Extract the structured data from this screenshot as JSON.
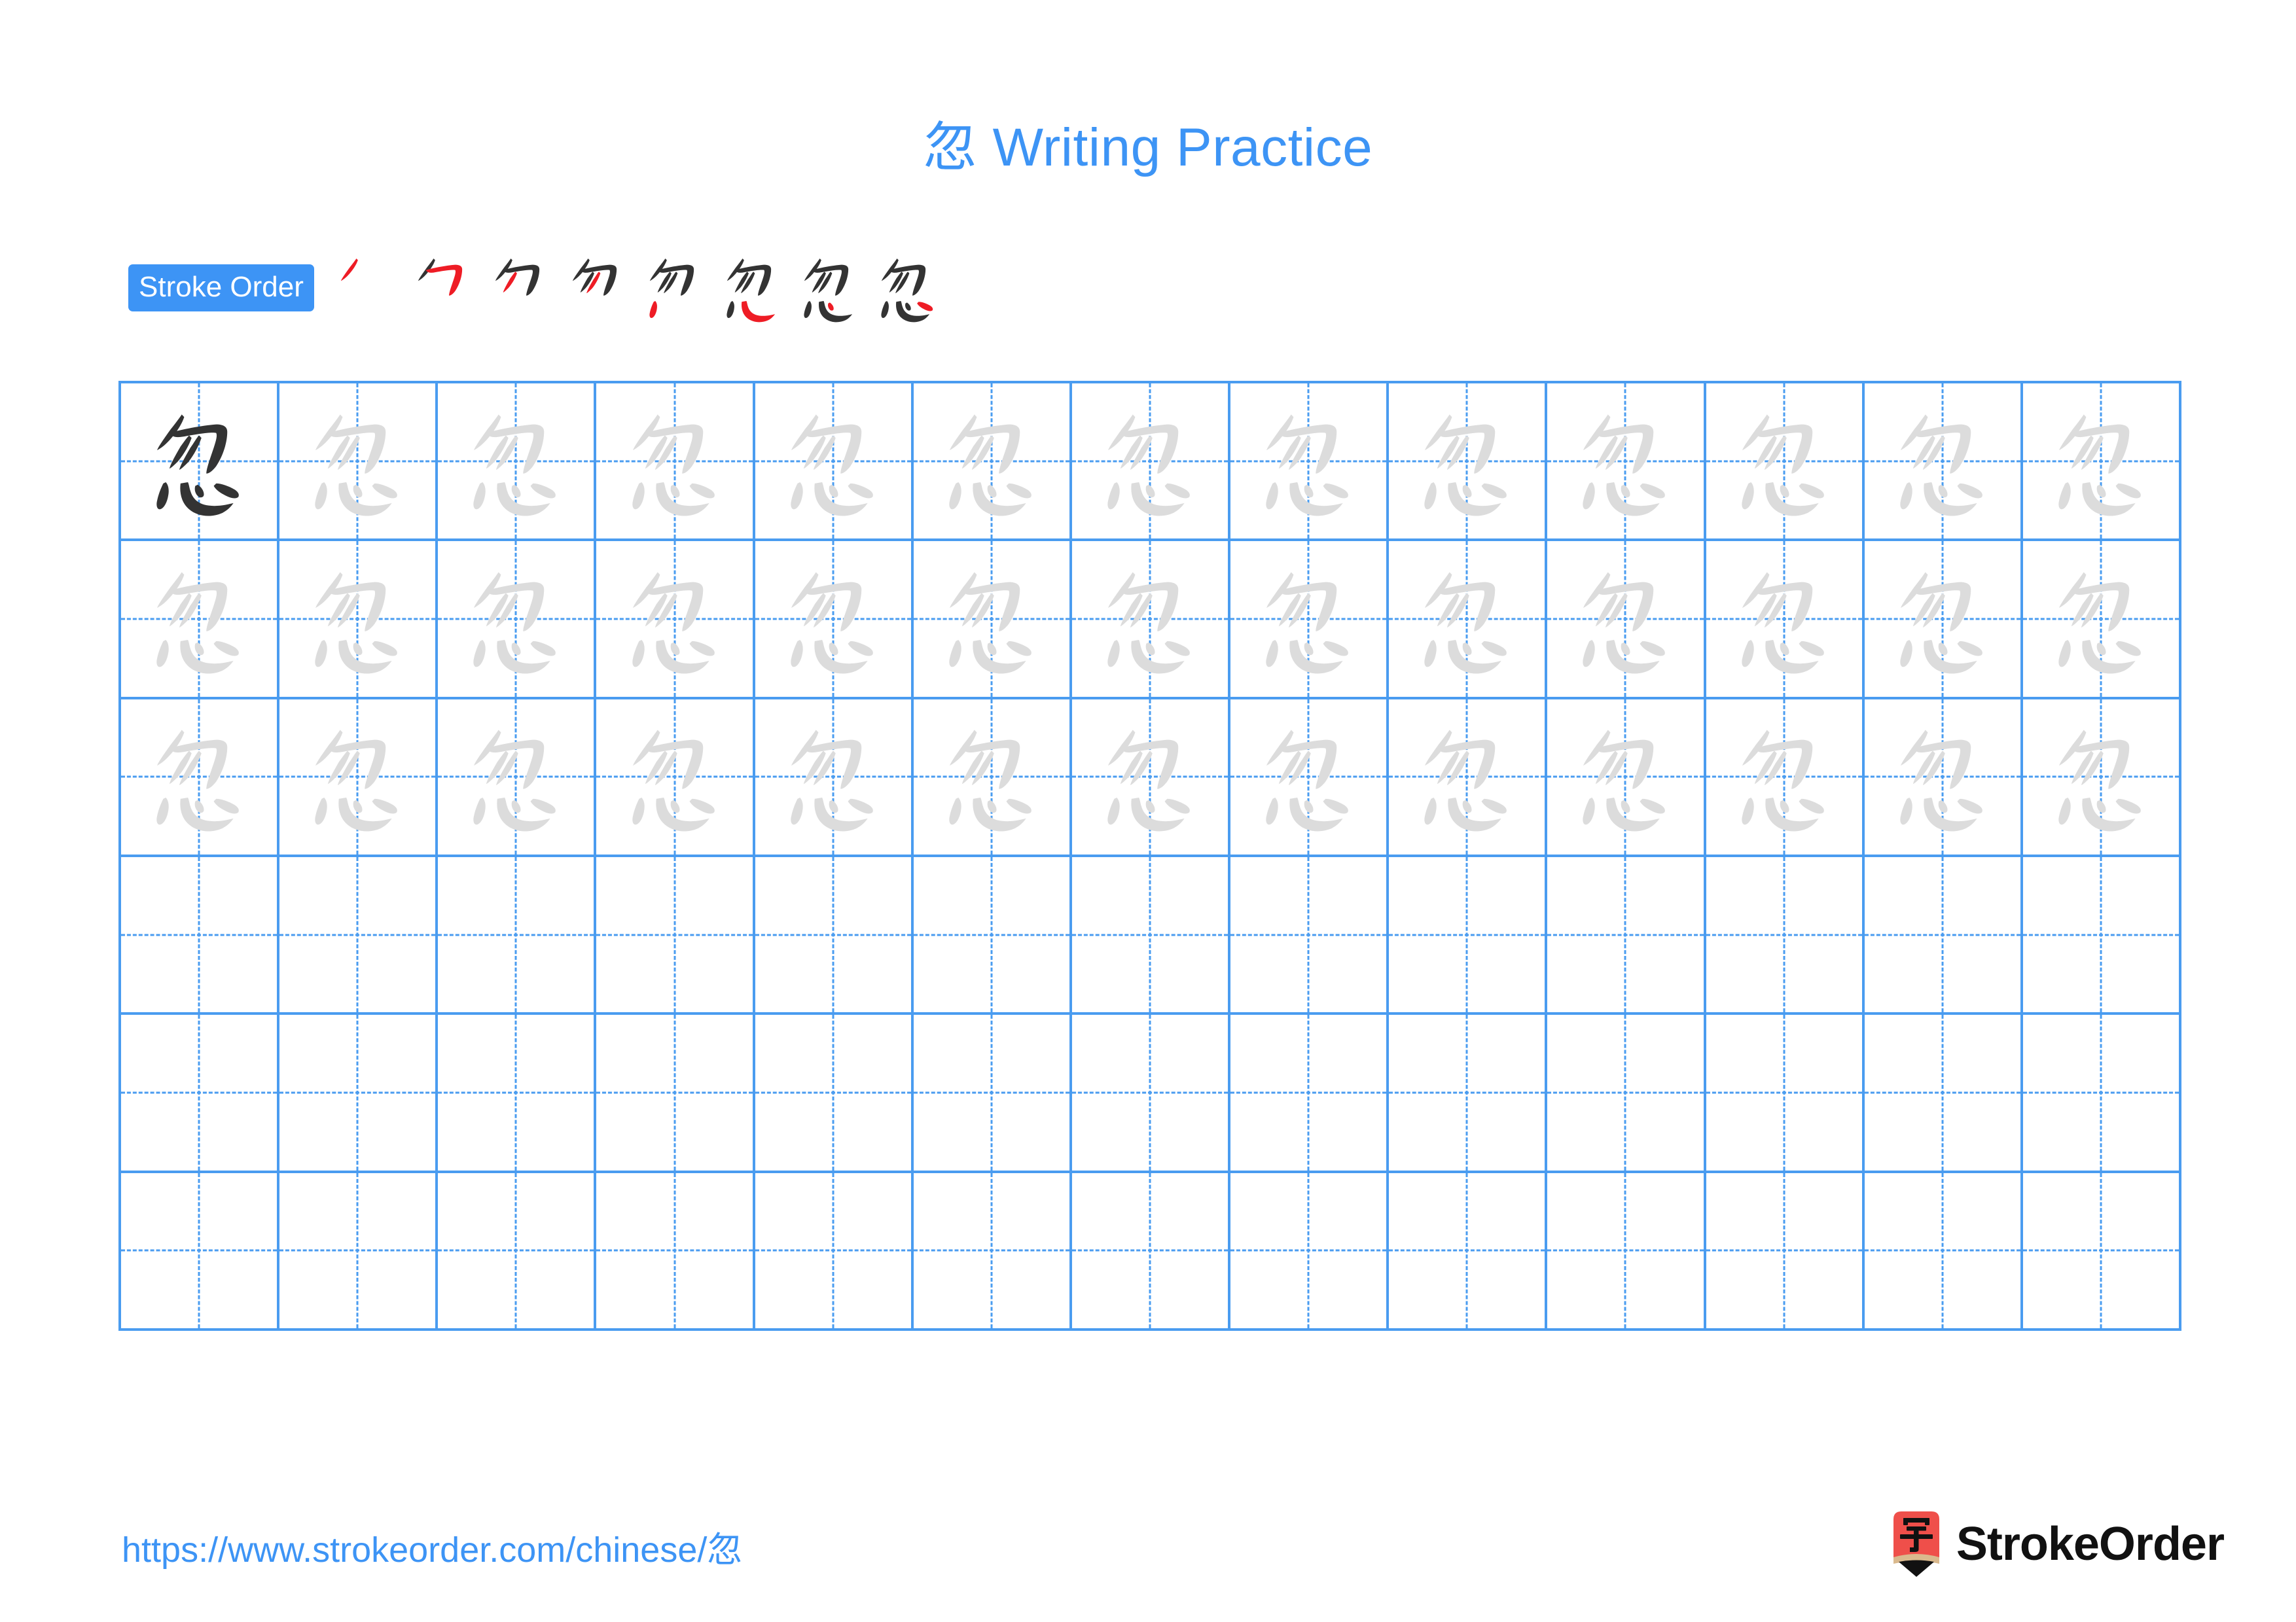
{
  "page": {
    "character": "忽",
    "title": "忽 Writing Practice",
    "title_character": "忽",
    "title_text": " Writing Practice",
    "background_color": "#ffffff",
    "accent_color": "#3d94f5",
    "grid_line_color": "#4a9cf0",
    "traced_char_color": "#dcdcdc",
    "solid_char_color": "#333333",
    "new_stroke_color": "#ee1c25"
  },
  "stroke_order": {
    "badge_label": "Stroke Order",
    "total_strokes": 8,
    "steps": [
      {
        "step": 1,
        "strokes_shown": 1,
        "new_stroke_index": 1
      },
      {
        "step": 2,
        "strokes_shown": 2,
        "new_stroke_index": 2
      },
      {
        "step": 3,
        "strokes_shown": 3,
        "new_stroke_index": 3
      },
      {
        "step": 4,
        "strokes_shown": 4,
        "new_stroke_index": 4
      },
      {
        "step": 5,
        "strokes_shown": 5,
        "new_stroke_index": 5
      },
      {
        "step": 6,
        "strokes_shown": 6,
        "new_stroke_index": 6
      },
      {
        "step": 7,
        "strokes_shown": 7,
        "new_stroke_index": 7
      },
      {
        "step": 8,
        "strokes_shown": 8,
        "new_stroke_index": 8
      }
    ]
  },
  "grid": {
    "columns": 13,
    "rows": 6,
    "cells": [
      [
        "solid",
        "trace",
        "trace",
        "trace",
        "trace",
        "trace",
        "trace",
        "trace",
        "trace",
        "trace",
        "trace",
        "trace",
        "trace"
      ],
      [
        "trace",
        "trace",
        "trace",
        "trace",
        "trace",
        "trace",
        "trace",
        "trace",
        "trace",
        "trace",
        "trace",
        "trace",
        "trace"
      ],
      [
        "trace",
        "trace",
        "trace",
        "trace",
        "trace",
        "trace",
        "trace",
        "trace",
        "trace",
        "trace",
        "trace",
        "trace",
        "trace"
      ],
      [
        "empty",
        "empty",
        "empty",
        "empty",
        "empty",
        "empty",
        "empty",
        "empty",
        "empty",
        "empty",
        "empty",
        "empty",
        "empty"
      ],
      [
        "empty",
        "empty",
        "empty",
        "empty",
        "empty",
        "empty",
        "empty",
        "empty",
        "empty",
        "empty",
        "empty",
        "empty",
        "empty"
      ],
      [
        "empty",
        "empty",
        "empty",
        "empty",
        "empty",
        "empty",
        "empty",
        "empty",
        "empty",
        "empty",
        "empty",
        "empty",
        "empty"
      ]
    ]
  },
  "footer": {
    "url_prefix": "https://www.strokeorder.com/chinese/",
    "url_character": "忽",
    "url_full": "https://www.strokeorder.com/chinese/忽",
    "brand_name": "StrokeOrder",
    "brand_icon_character": "字",
    "brand_icon_body_color": "#ef4f4a",
    "brand_icon_wood_color": "#dab98d",
    "brand_icon_tip_color": "#111111"
  }
}
